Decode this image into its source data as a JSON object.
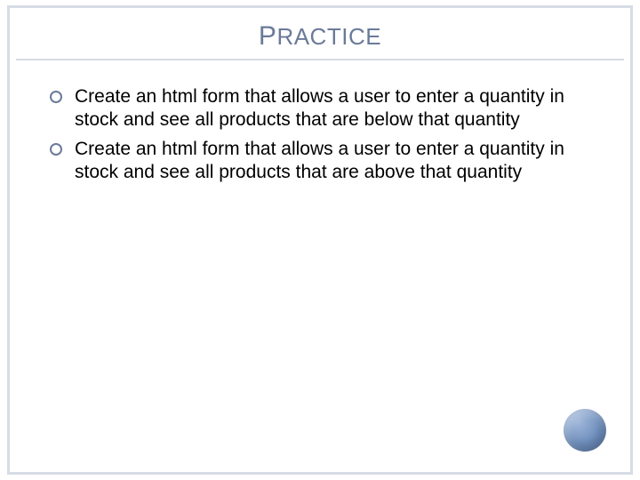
{
  "slide": {
    "title_leading": "P",
    "title_rest": "RACTICE",
    "bullets": [
      {
        "text": "Create an html form that allows a user to enter a quantity in stock and see all products that are below that quantity"
      },
      {
        "text": "Create an html form that allows a user to enter a quantity in stock and see all products that are above that quantity"
      }
    ]
  }
}
